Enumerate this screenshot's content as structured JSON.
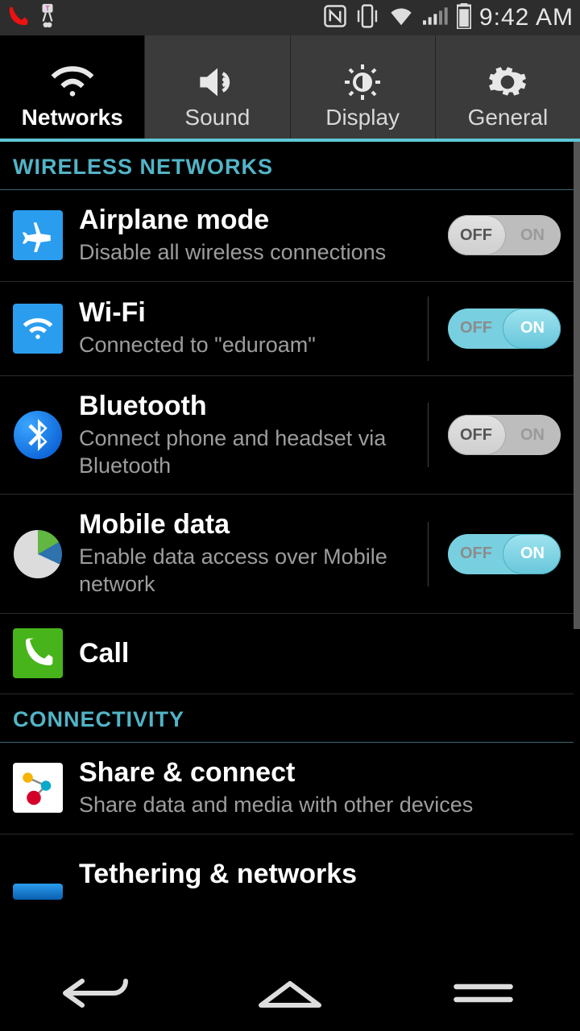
{
  "statusbar": {
    "time": "9:42 AM"
  },
  "tabs": [
    {
      "label": "Networks",
      "selected": true
    },
    {
      "label": "Sound",
      "selected": false
    },
    {
      "label": "Display",
      "selected": false
    },
    {
      "label": "General",
      "selected": false
    }
  ],
  "sections": {
    "wireless_header": "WIRELESS NETWORKS",
    "connectivity_header": "CONNECTIVITY"
  },
  "toggle": {
    "off": "OFF",
    "on": "ON"
  },
  "items": {
    "airplane": {
      "title": "Airplane mode",
      "sub": "Disable all wireless connections",
      "state": "off"
    },
    "wifi": {
      "title": "Wi-Fi",
      "sub": "Connected to \"eduroam\"",
      "state": "on"
    },
    "bluetooth": {
      "title": "Bluetooth",
      "sub": "Connect phone and headset via Bluetooth",
      "state": "off"
    },
    "mobile": {
      "title": "Mobile data",
      "sub": "Enable data access over Mobile network",
      "state": "on"
    },
    "call": {
      "title": "Call"
    },
    "share": {
      "title": "Share & connect",
      "sub": "Share data and media with other devices"
    },
    "tether": {
      "title": "Tethering & networks"
    }
  }
}
